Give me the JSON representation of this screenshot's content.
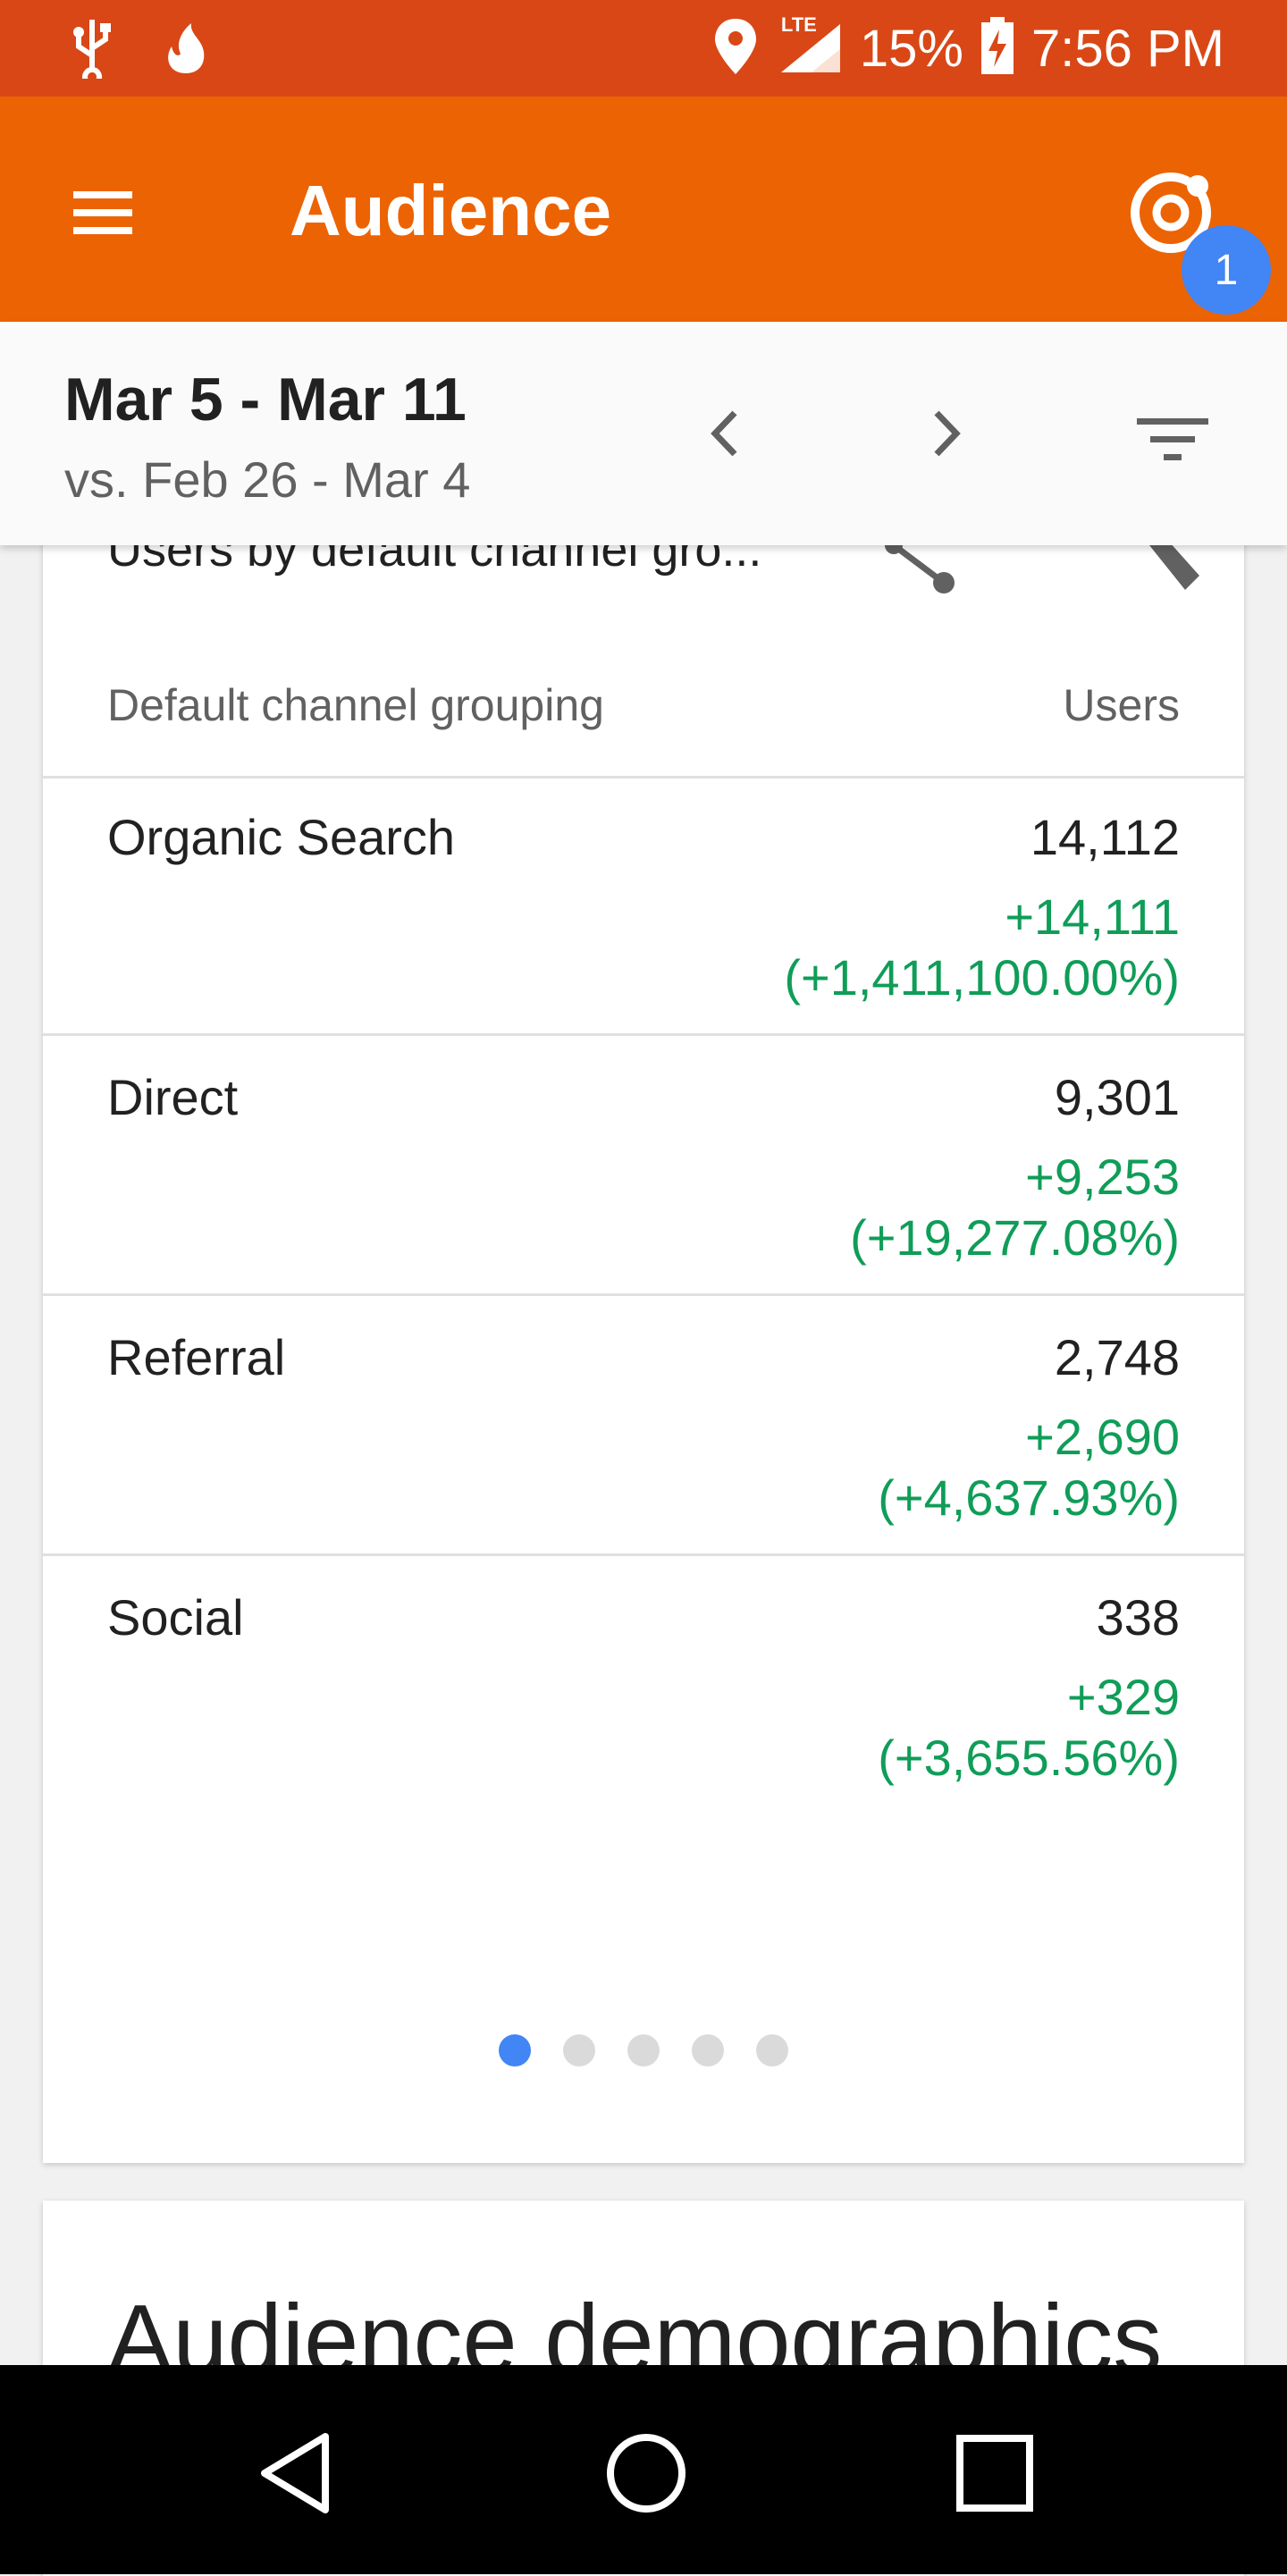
{
  "status_bar": {
    "battery": "15%",
    "time": "7:56 PM",
    "network": "LTE",
    "icons": [
      "usb-icon",
      "fire-icon",
      "location-icon",
      "signal-icon",
      "battery-charging-icon"
    ]
  },
  "app_bar": {
    "title": "Audience",
    "badge": "1",
    "color": "#ec6304"
  },
  "date_range": {
    "current": "Mar 5 - Mar 11",
    "compare": "vs. Feb 26 - Mar 4"
  },
  "card": {
    "title": "Users by default channel gro...",
    "column_left": "Default channel grouping",
    "column_right": "Users",
    "rows": [
      {
        "name": "Organic Search",
        "value": "14,112",
        "delta": "+14,111",
        "percent": "(+1,411,100.00%)"
      },
      {
        "name": "Direct",
        "value": "9,301",
        "delta": "+9,253",
        "percent": "(+19,277.08%)"
      },
      {
        "name": "Referral",
        "value": "2,748",
        "delta": "+2,690",
        "percent": "(+4,637.93%)"
      },
      {
        "name": "Social",
        "value": "338",
        "delta": "+329",
        "percent": "(+3,655.56%)"
      }
    ],
    "pages": 5,
    "active_page": 1
  },
  "card2": {
    "title": "Audience demographics"
  }
}
